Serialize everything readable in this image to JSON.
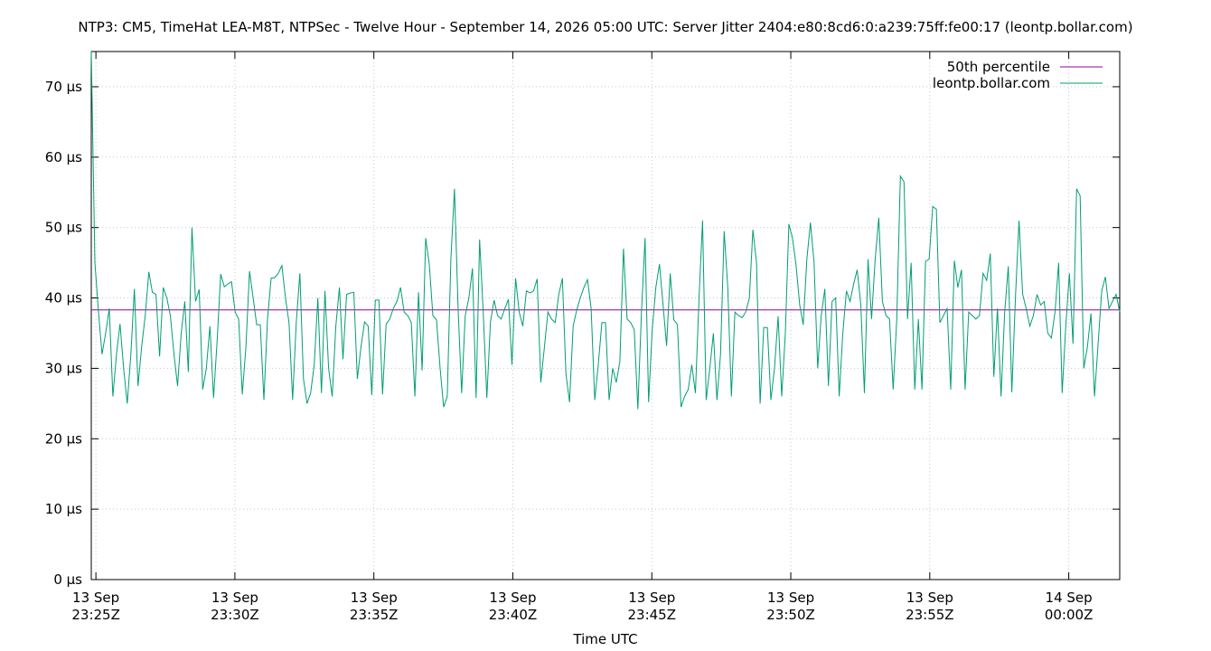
{
  "chart_data": {
    "type": "line",
    "title": "NTP3: CM5, TimeHat LEA-M8T, NTPSec - Twelve Hour - September 14, 2026 05:00 UTC: Server Jitter 2404:e80:8cd6:0:a239:75ff:fe00:17 (leontp.bollar.com)",
    "xlabel": "Time UTC",
    "ylabel": "",
    "ylim": [
      0,
      75
    ],
    "xlim": [
      "2026-09-13T23:24:50Z",
      "2026-09-14T00:01:50Z"
    ],
    "yticks": [
      "0 µs",
      "10 µs",
      "20 µs",
      "30 µs",
      "40 µs",
      "50 µs",
      "60 µs",
      "70 µs"
    ],
    "xticks": [
      {
        "line1": "13 Sep",
        "line2": "23:25Z"
      },
      {
        "line1": "13 Sep",
        "line2": "23:30Z"
      },
      {
        "line1": "13 Sep",
        "line2": "23:35Z"
      },
      {
        "line1": "13 Sep",
        "line2": "23:40Z"
      },
      {
        "line1": "13 Sep",
        "line2": "23:45Z"
      },
      {
        "line1": "13 Sep",
        "line2": "23:50Z"
      },
      {
        "line1": "13 Sep",
        "line2": "23:55Z"
      },
      {
        "line1": "14 Sep",
        "line2": "00:00Z"
      }
    ],
    "grid": true,
    "legend_position": "top-right",
    "series": [
      {
        "name": "50th percentile",
        "color": "#94009c",
        "y_constant": 38.3
      },
      {
        "name": "leontp.bollar.com",
        "color": "#009e73",
        "values": [
          75,
          45,
          38,
          32,
          35,
          38.5,
          26,
          32,
          36.3,
          30,
          25,
          32,
          41.3,
          27.5,
          33,
          37.5,
          43.7,
          40.8,
          40.5,
          31.7,
          41.5,
          40,
          37.5,
          32,
          27.5,
          35,
          39.5,
          29.5,
          50,
          39.5,
          41.2,
          27,
          30,
          36,
          25.8,
          34,
          43.4,
          41.6,
          42,
          42.3,
          38,
          37,
          26.3,
          33,
          43.8,
          40,
          36.2,
          36.2,
          25.5,
          37,
          42.8,
          42.9,
          43.5,
          44.6,
          40,
          36.5,
          25.5,
          36.5,
          43.5,
          28.5,
          25,
          26.5,
          30.5,
          40,
          26.5,
          41,
          30,
          26,
          36,
          41.5,
          31.3,
          40.5,
          40.7,
          40.8,
          28.5,
          33,
          36.6,
          36,
          26.2,
          39.7,
          39.7,
          26.3,
          36.3,
          37,
          38.5,
          39.5,
          41.5,
          38,
          37.5,
          36.5,
          26,
          40.8,
          29.7,
          48.5,
          44.8,
          37.5,
          36.9,
          30,
          24.5,
          26,
          45.5,
          55.5,
          38.5,
          26.5,
          37.5,
          40,
          44.2,
          25.8,
          48.3,
          38,
          25.8,
          36.6,
          39.7,
          37.5,
          37,
          38.5,
          39.8,
          30.5,
          42.8,
          38,
          36,
          41,
          40.7,
          41,
          42.7,
          28,
          33,
          38,
          37,
          36.5,
          40.5,
          42.8,
          29.3,
          25.2,
          36,
          38.3,
          40,
          41.5,
          42.6,
          38.5,
          25.5,
          30.5,
          36.5,
          36.5,
          25.5,
          30,
          28,
          31,
          47,
          37,
          36.5,
          35.5,
          24.2,
          38,
          48.5,
          25.2,
          35.5,
          41.5,
          44.8,
          39,
          33.2,
          43.5,
          36.9,
          36.2,
          24.5,
          26,
          27,
          30.5,
          26.5,
          40,
          51,
          25.5,
          30,
          35,
          25.5,
          32,
          49.5,
          41.5,
          26,
          38,
          37.5,
          37.2,
          38,
          40,
          49.7,
          45,
          25,
          35.8,
          35.8,
          25.5,
          30,
          37.4,
          26,
          35,
          50.5,
          48.5,
          44.6,
          39,
          36.2,
          45.5,
          50.7,
          45,
          30,
          37.5,
          41.3,
          27.5,
          39.5,
          40,
          26,
          35,
          41,
          39.5,
          42,
          44,
          39,
          26.5,
          45.5,
          37,
          45.5,
          51.4,
          39.5,
          37.5,
          37,
          27,
          37,
          57.3,
          56.5,
          37,
          45,
          27,
          37,
          27,
          45.2,
          45.5,
          53,
          52.6,
          36.5,
          37.5,
          38.5,
          27,
          45.3,
          41.5,
          44,
          27,
          38,
          37.5,
          37,
          37.5,
          43.5,
          42.5,
          46.3,
          28.8,
          38.5,
          26,
          38,
          44.5,
          26.6,
          40,
          51,
          40.5,
          38.5,
          36,
          37.5,
          40.5,
          39,
          39.5,
          35,
          34.3,
          38,
          45,
          26.5,
          36,
          43.5,
          33.5,
          55.5,
          54.5,
          30,
          33,
          37.8,
          26,
          33.5,
          41,
          43,
          38.5,
          39.5,
          40.5,
          38
        ]
      }
    ]
  }
}
